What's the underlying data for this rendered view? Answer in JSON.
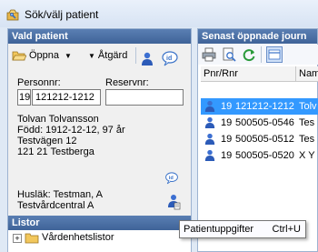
{
  "window": {
    "title": "Sök/välj patient"
  },
  "left_panel": {
    "header": "Vald patient",
    "toolbar": {
      "open_label": "Öppna",
      "action_label": "Åtgärd"
    },
    "fields": {
      "personnr_label": "Personnr:",
      "reservnr_label": "Reservnr:",
      "century_value": "19",
      "personnr_value": "121212-1212",
      "reservnr_value": ""
    },
    "patient": {
      "name": "Tolvan Tolvansson",
      "born": "Född: 1912-12-12, 97 år",
      "street": "Testvägen 12",
      "city": "121 21 Testberga"
    },
    "doctor": {
      "line1": "Husläk: Testman, A",
      "line2": "Testvårdcentral A"
    }
  },
  "lists_panel": {
    "header": "Listor",
    "tree_item": "Vårdenhetslistor"
  },
  "right_panel": {
    "header": "Senast öppnade journ",
    "columns": [
      "Pnr/Rnr",
      "Nam"
    ],
    "rows": [
      {
        "century": "19",
        "pnr": "121212-1212",
        "name": "Tolv",
        "selected": true
      },
      {
        "century": "19",
        "pnr": "500505-0546",
        "name": "Tes",
        "selected": false
      },
      {
        "century": "19",
        "pnr": "500505-0512",
        "name": "Tes",
        "selected": false
      },
      {
        "century": "19",
        "pnr": "500505-0520",
        "name": "X Y",
        "selected": false
      }
    ]
  },
  "tooltip": {
    "text": "Patientuppgifter",
    "shortcut": "Ctrl+U"
  },
  "colors": {
    "header_bg": "#4a70a8",
    "selection": "#3399ff",
    "title_bar": "#dbe6f4"
  }
}
